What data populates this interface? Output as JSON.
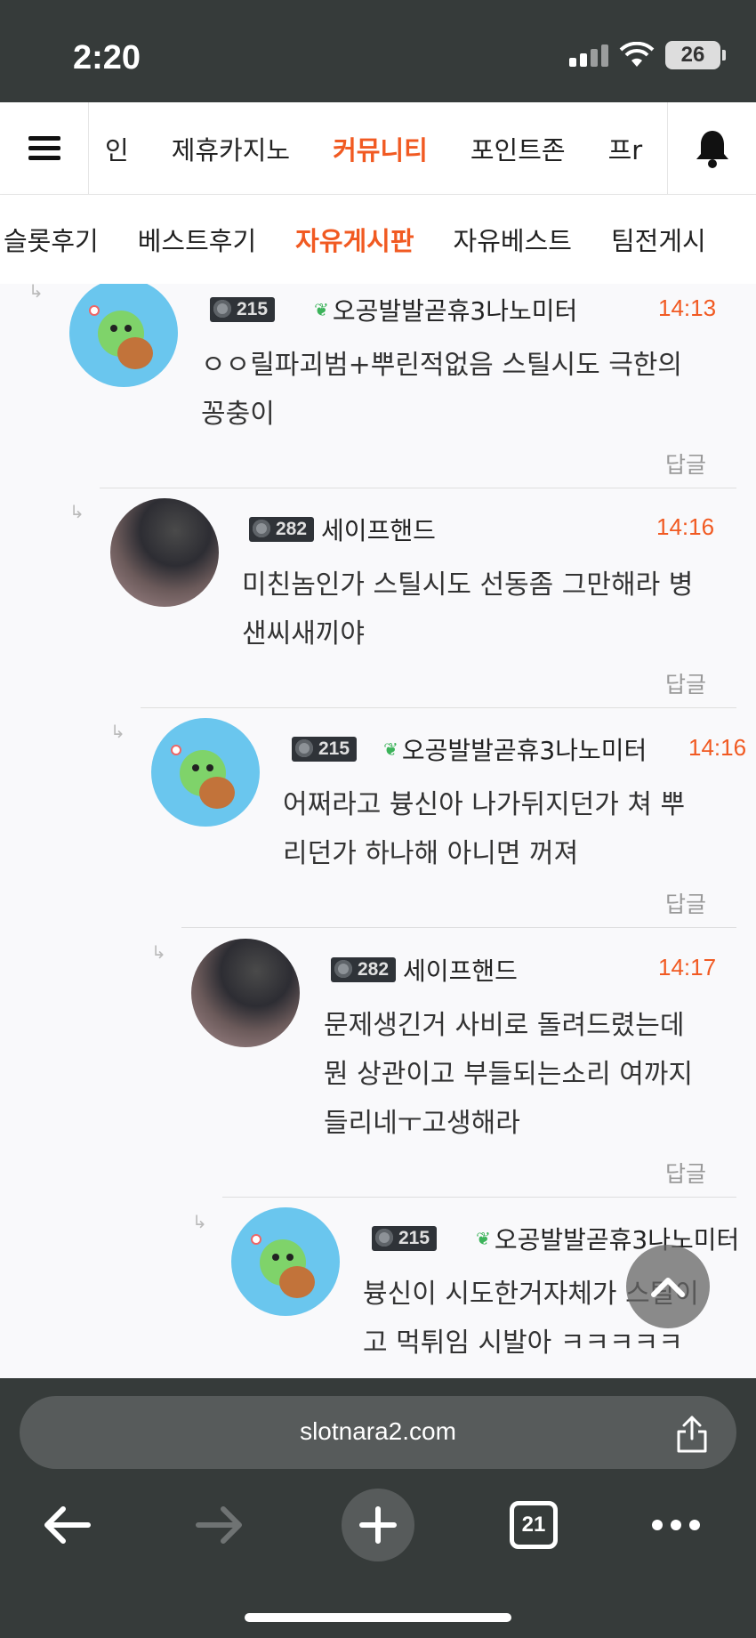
{
  "status_bar": {
    "time": "2:20",
    "battery": "26"
  },
  "top_nav": {
    "items": [
      "인",
      "제휴카지노",
      "커뮤니티",
      "포인트존",
      "프r"
    ],
    "active_index": 2
  },
  "sub_nav": {
    "items": [
      "슬롯후기",
      "베스트후기",
      "자유게시판",
      "자유베스트",
      "팀전게시"
    ],
    "active_index": 2
  },
  "comments": [
    {
      "level": "215",
      "username": "오공발발곧휴3나노미터",
      "time": "14:13",
      "line1": "ㅇㅇ릴파괴범+뿌린적없음 스틸시도 극한의",
      "line2": "꽁충이",
      "line3": "",
      "reply": "답글",
      "avatar": "turtle",
      "leaf": true
    },
    {
      "level": "282",
      "username": "세이프핸드",
      "time": "14:16",
      "line1": "미친놈인가 스틸시도 선동좀 그만해라 병",
      "line2": "샌씨새끼야",
      "line3": "",
      "reply": "답글",
      "avatar": "photo",
      "leaf": false
    },
    {
      "level": "215",
      "username": "오공발발곧휴3나노미터",
      "time": "14:16",
      "line1": "어쩌라고 븅신아 나가뒤지던가 쳐 뿌",
      "line2": "리던가 하나해 아니면 꺼져",
      "line3": "",
      "reply": "답글",
      "avatar": "turtle",
      "leaf": true
    },
    {
      "level": "282",
      "username": "세이프핸드",
      "time": "14:17",
      "line1": "문제생긴거 사비로 돌려드렸는데",
      "line2": "뭔 상관이고 부들되는소리 여까지",
      "line3": "들리네ㅜ고생해라",
      "reply": "답글",
      "avatar": "photo",
      "leaf": false
    },
    {
      "level": "215",
      "username": "오공발발곧휴3나노미터",
      "time": "",
      "line1": "븅신이 시도한거자체가 스틸이",
      "line2": "고 먹튀임 시발아 ㅋㅋㅋㅋㅋ",
      "line3": "",
      "reply": "",
      "avatar": "turtle",
      "leaf": true
    }
  ],
  "browser": {
    "url": "slotnara2.com",
    "tab_count": "21"
  },
  "colors": {
    "accent": "#f15a22",
    "chrome": "#363b3a",
    "level_badge": "#2f3338",
    "turtle_bg": "#6ac6ee"
  },
  "icons": {
    "menu": "hamburger-icon",
    "notifications": "bell-icon",
    "scroll_top": "chevron-up-icon",
    "share": "share-icon",
    "back": "arrow-left-icon",
    "forward": "arrow-right-icon",
    "new_tab": "plus-icon",
    "more": "more-icon"
  }
}
